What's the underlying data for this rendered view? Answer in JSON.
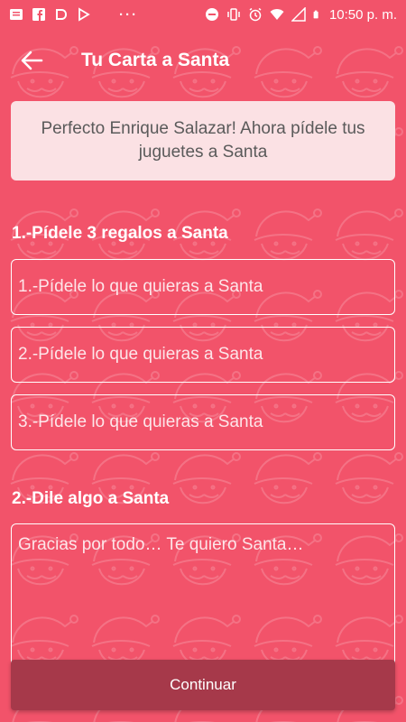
{
  "status_bar": {
    "dots": "···",
    "time": "10:50 p. m."
  },
  "app_bar": {
    "title": "Tu Carta a Santa",
    "back_icon": "arrow-left-icon"
  },
  "banner": {
    "text": "Perfecto Enrique Salazar! Ahora pídele tus juguetes a Santa"
  },
  "section1": {
    "label": "1.-Pídele 3 regalos a Santa",
    "fields": [
      {
        "placeholder": "1.-Pídele lo que quieras a Santa"
      },
      {
        "placeholder": "2.-Pídele lo que quieras a Santa"
      },
      {
        "placeholder": "3.-Pídele lo que quieras a Santa"
      }
    ]
  },
  "section2": {
    "label": "2.-Dile algo a Santa",
    "placeholder": "Gracias por todo… Te quiero Santa…"
  },
  "continue_label": "Continuar",
  "colors": {
    "background": "#f2536a",
    "banner": "#fbe1e4",
    "button": "#a6394a"
  }
}
